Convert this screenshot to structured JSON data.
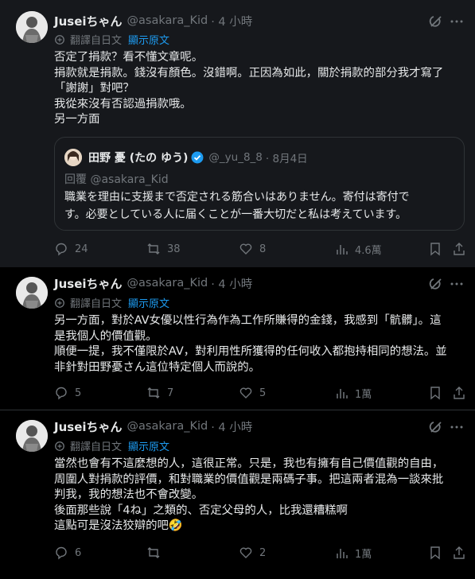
{
  "tweets": [
    {
      "name": "Juseiちゃん",
      "handle": "@asakara_Kid",
      "time": "· 4 小時",
      "translate_label": "翻譯自日文",
      "show_original": "顯示原文",
      "lines": [
        "否定了捐款？看不懂文章呢。",
        "捐款就是捐款。錢沒有顏色。沒錯啊。正因為如此，關於捐款的部分我才寫了",
        "「謝謝」對吧？",
        "我從來沒有否認過捐款哦。",
        "另一方面"
      ],
      "quote": {
        "name": "田野 憂 (たの ゆう)",
        "handle": "@_yu_8_8",
        "time": "· 8月4日",
        "reply_to": "回覆 @asakara_Kid",
        "lines": [
          "職業を理由に支援まで否定される筋合いはありません。寄付は寄付で",
          "す。必要としている人に届くことが一番大切だと私は考えています。"
        ]
      },
      "stats": {
        "replies": "24",
        "reposts": "38",
        "likes": "8",
        "views": "4.6萬"
      }
    },
    {
      "name": "Juseiちゃん",
      "handle": "@asakara_Kid",
      "time": "· 4 小時",
      "translate_label": "翻譯自日文",
      "show_original": "顯示原文",
      "lines": [
        "另一方面，對於AV女優以性行為作為工作所賺得的金錢，我感到「骯髒」。這",
        "是我個人的價值觀。",
        "順便一提，我不僅限於AV，對利用性所獲得的任何收入都抱持相同的想法。並",
        "非針對田野憂さん這位特定個人而說的。"
      ],
      "stats": {
        "replies": "5",
        "reposts": "7",
        "likes": "5",
        "views": "1萬"
      }
    },
    {
      "name": "Juseiちゃん",
      "handle": "@asakara_Kid",
      "time": "· 4 小時",
      "translate_label": "翻譯自日文",
      "show_original": "顯示原文",
      "lines": [
        "當然也會有不這麼想的人，這很正常。只是，我也有擁有自己價值觀的自由，",
        "周圍人對捐款的評價，和對職業的價值觀是兩碼子事。把這兩者混為一談來批",
        "判我，我的想法也不會改變。",
        "後面那些說「4ね」之類的、否定父母的人，比我還糟糕啊",
        "這點可是沒法狡辯的吧🤣"
      ],
      "stats": {
        "replies": "6",
        "reposts": "",
        "likes": "2",
        "views": "1萬"
      }
    }
  ],
  "icons": {
    "reply": "reply-icon",
    "repost": "repost-icon",
    "like": "heart-icon",
    "views": "analytics-icon",
    "bookmark": "bookmark-icon",
    "share": "share-icon",
    "grok": "grok-icon",
    "more": "more-icon",
    "translate": "translate-icon",
    "verified": "verified-badge-icon"
  },
  "colors": {
    "background": "#000000",
    "text": "#e7e9ea",
    "muted": "#71767b",
    "accent": "#1d9bf0"
  }
}
